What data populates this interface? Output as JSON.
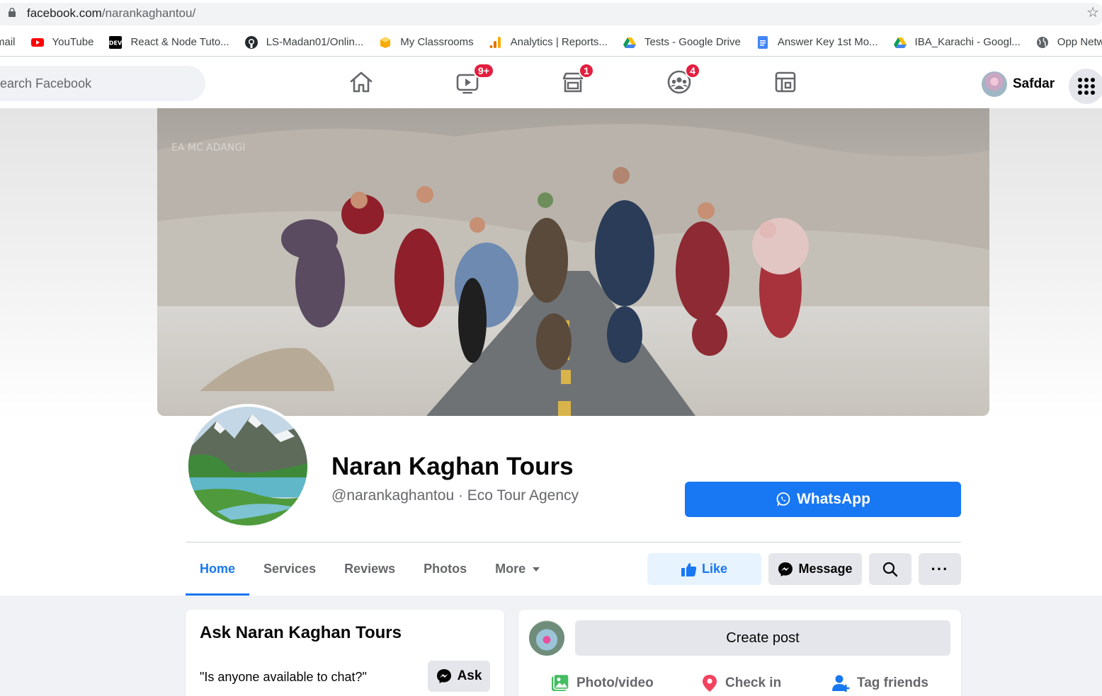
{
  "browser": {
    "url_host": "facebook.com",
    "url_path": "/narankaghantou/",
    "bookmarks": [
      {
        "label": "mail",
        "icon": "gmail-icon"
      },
      {
        "label": "YouTube",
        "icon": "youtube-icon"
      },
      {
        "label": "React & Node Tuto...",
        "icon": "dev-icon"
      },
      {
        "label": "LS-Madan01/Onlin...",
        "icon": "github-icon"
      },
      {
        "label": "My Classrooms",
        "icon": "classroom-icon"
      },
      {
        "label": "Analytics | Reports...",
        "icon": "analytics-icon"
      },
      {
        "label": "Tests - Google Drive",
        "icon": "google-drive-icon"
      },
      {
        "label": "Answer Key 1st Mo...",
        "icon": "google-docs-icon"
      },
      {
        "label": "IBA_Karachi - Googl...",
        "icon": "google-drive-icon"
      },
      {
        "label": "Opp Network",
        "icon": "globe-icon"
      }
    ]
  },
  "topbar": {
    "search_placeholder": "earch Facebook",
    "badges": {
      "watch": "9+",
      "marketplace": "1",
      "groups": "4"
    },
    "profile_name": "Safdar"
  },
  "page": {
    "name": "Naran Kaghan Tours",
    "subtitle": "@narankaghantou · Eco Tour Agency",
    "whatsapp_label": "WhatsApp",
    "tabs": [
      "Home",
      "Services",
      "Reviews",
      "Photos",
      "More"
    ],
    "like_label": "Like",
    "message_label": "Message",
    "more_label": "···"
  },
  "ask_card": {
    "title": "Ask Naran Kaghan Tours",
    "question": "\"Is anyone available to chat?\"",
    "ask_label": "Ask"
  },
  "post_card": {
    "create_label": "Create post",
    "actions": [
      "Photo/video",
      "Check in",
      "Tag friends"
    ]
  },
  "colors": {
    "fb_blue": "#1877f2",
    "badge_red": "#e41e3f",
    "text_secondary": "#65676b",
    "button_gray": "#e4e6eb",
    "like_bg": "#e7f3ff"
  }
}
